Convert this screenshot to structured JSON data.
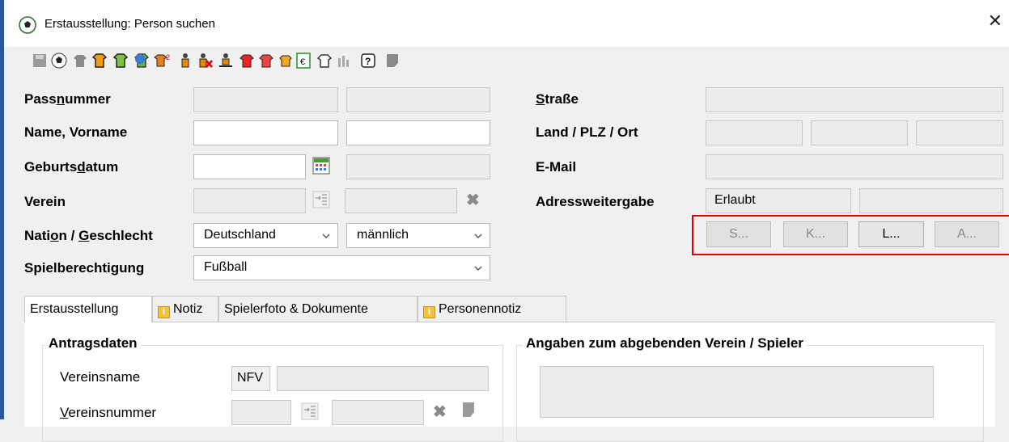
{
  "window": {
    "title": "Erstausstellung: Person suchen",
    "close_label": "✕"
  },
  "toolbar": {
    "icons": [
      "save-icon",
      "football-icon",
      "shirt-gray-icon",
      "shirt-orange-icon",
      "shirt-green-icon",
      "shirt-question-icon",
      "shirt-two-icon",
      "person-icon",
      "person-remove-icon",
      "person-move-icon",
      "shirt-red-icon",
      "shirt-red-2-icon",
      "shirt-small-icon",
      "invoice-icon",
      "shirt-outline-icon",
      "chart-icon",
      "help-icon",
      "document-icon"
    ],
    "shirt_two_sup": "2"
  },
  "left_form": {
    "passnummer": {
      "label_pre": "Pass",
      "label_u": "n",
      "label_post": "ummer"
    },
    "name": {
      "label": "Name, Vorname"
    },
    "geburtsdatum": {
      "label_pre": "Geburts",
      "label_u": "d",
      "label_post": "atum"
    },
    "verein": {
      "label": "Verein"
    },
    "nation": {
      "label_pre": "Nati",
      "label_u": "o",
      "label_mid": "n / ",
      "label_u2": "G",
      "label_post": "eschlecht",
      "nation_value": "Deutschland",
      "geschlecht_value": "männlich"
    },
    "spielberechtigung": {
      "label": "Spielberechtigung",
      "value": "Fußball"
    }
  },
  "right_form": {
    "strasse": {
      "label_u": "S",
      "label_post": "traße"
    },
    "land": {
      "label": "Land / PLZ / Ort"
    },
    "email": {
      "label": "E-Mail"
    },
    "adressweitergabe": {
      "label": "Adressweitergabe",
      "value": "Erlaubt"
    },
    "buttons": [
      "S...",
      "K...",
      "L...",
      "A..."
    ]
  },
  "tabs": [
    "Erstausstellung",
    "Notiz",
    "Spielerfoto & Dokumente",
    "Personennotiz"
  ],
  "tab_info_icon": "i",
  "panel": {
    "antragsdaten_title": "Antragsdaten",
    "vereinsname_label": "Vereinsname",
    "vereinsname_prefix": "NFV",
    "vereinsnummer_label_u": "V",
    "vereinsnummer_label_post": "ereinsnummer",
    "abgebend_title": "Angaben zum abgebenden Verein / Spieler"
  },
  "colors": {
    "highlight": "#e00000",
    "titlebar_accent": "#2b579a",
    "info_badge": "#f7c23a"
  }
}
